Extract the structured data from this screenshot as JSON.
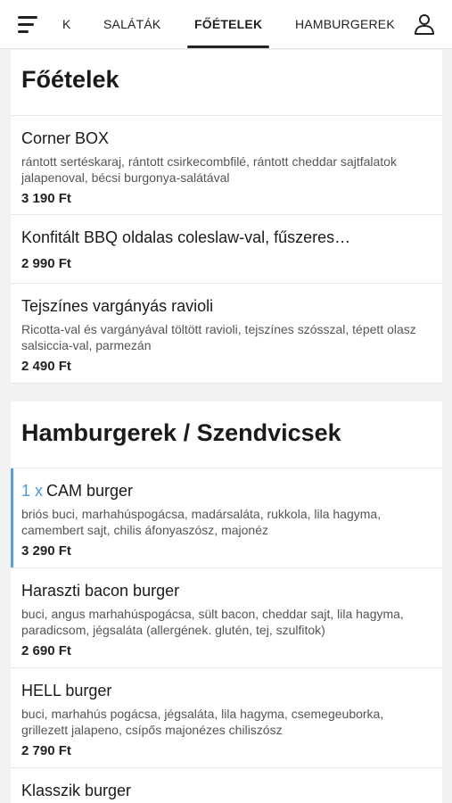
{
  "nav": {
    "tabs": [
      {
        "label": "K"
      },
      {
        "label": "SALÁTÁK"
      },
      {
        "label": "FŐÉTELEK"
      },
      {
        "label": "HAMBURGEREK"
      }
    ],
    "active_tab": "FŐÉTELEK"
  },
  "sections": [
    {
      "title": "Főételek",
      "items": [
        {
          "name": "Corner BOX",
          "description": "rántott sertéskaraj, rántott csirkecombfilé, rántott cheddar sajtfalatok jalapenoval, bécsi burgonya-salátával",
          "price": "3 190 Ft"
        },
        {
          "name": "Konfitált BBQ oldalas coleslaw-val, fűszeres…",
          "description": "",
          "price": "2 990 Ft"
        },
        {
          "name": "Tejszínes vargányás ravioli",
          "description": "Ricotta-val és vargányával töltött ravioli, tejszínes szósszal, tépett olasz salsiccia-val, parmezán",
          "price": "2 490 Ft"
        }
      ]
    },
    {
      "title": "Hamburgerek / Szendvicsek",
      "items": [
        {
          "qty": "1 x",
          "name": "CAM burger",
          "description": "briós buci, marhahúspogácsa, madársaláta, rukkola, lila hagyma, camembert sajt, chilis áfonyaszósz, majonéz",
          "price": "3 290 Ft"
        },
        {
          "name": "Haraszti bacon burger",
          "description": "buci, angus marhahúspogácsa, sült bacon, cheddar sajt, lila hagyma, paradicsom, jégsaláta (allergének. glutén, tej, szulfitok)",
          "price": "2 690 Ft"
        },
        {
          "name": "HELL burger",
          "description": "buci, marhahús pogácsa, jégsaláta, lila hagyma, csemegeuborka, grillezett jalapeno, csípős majonézes chiliszósz",
          "price": "2 790 Ft"
        },
        {
          "name": "Klasszik burger",
          "description": "",
          "price": ""
        }
      ]
    }
  ],
  "colors": {
    "accent": "#4a9be0",
    "selected_bar": "#5aa0e6"
  },
  "icons": {
    "menu": "menu-icon",
    "user": "user-icon"
  }
}
